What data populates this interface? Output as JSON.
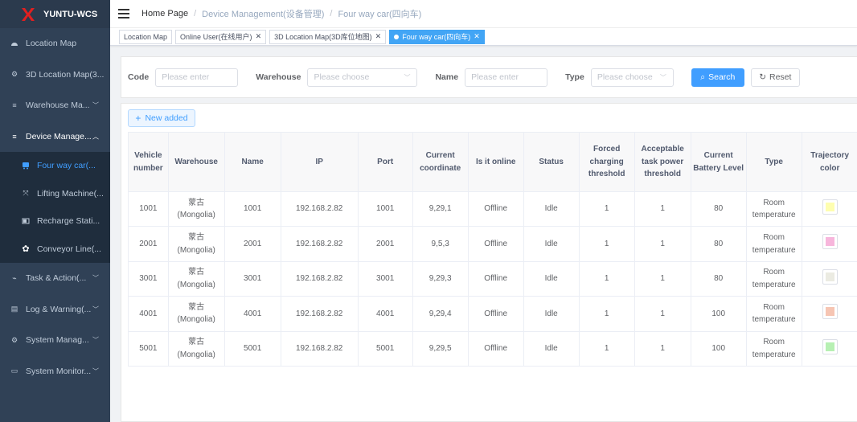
{
  "app": {
    "title": "YUNTU-WCS"
  },
  "sidebar": {
    "items": [
      {
        "label": "Location Map",
        "icon": "dashboard-icon"
      },
      {
        "label": "3D Location Map(3...",
        "icon": "gear-small-icon"
      },
      {
        "label": "Warehouse Ma...",
        "icon": "list-icon",
        "expandable": true
      },
      {
        "label": "Device Manage...",
        "icon": "list-icon",
        "expandable": true,
        "expanded": true,
        "children": [
          {
            "label": "Four way car(...",
            "icon": "bus-icon",
            "active": true
          },
          {
            "label": "Lifting Machine(...",
            "icon": "lift-icon"
          },
          {
            "label": "Recharge Stati...",
            "icon": "battery-icon"
          },
          {
            "label": "Conveyor Line(...",
            "icon": "cog-icon"
          }
        ]
      },
      {
        "label": "Task & Action(...",
        "icon": "task-icon",
        "expandable": true
      },
      {
        "label": "Log & Warning(...",
        "icon": "log-icon",
        "expandable": true
      },
      {
        "label": "System Manag...",
        "icon": "gear-small-icon",
        "expandable": true
      },
      {
        "label": "System Monitor...",
        "icon": "monitor-icon",
        "expandable": true
      }
    ]
  },
  "breadcrumb": {
    "home": "Home Page",
    "sep": "/",
    "level2": "Device Management(设备管理)",
    "level3": "Four way car(四向车)"
  },
  "tags": [
    {
      "label": "Location Map",
      "closable": false
    },
    {
      "label": "Online User(在线用户)",
      "closable": true
    },
    {
      "label": "3D Location Map(3D库位地图)",
      "closable": true
    },
    {
      "label": "Four way car(四向车)",
      "closable": true,
      "active": true
    }
  ],
  "search": {
    "code": {
      "label": "Code",
      "placeholder": "Please enter"
    },
    "warehouse": {
      "label": "Warehouse",
      "placeholder": "Please choose"
    },
    "name": {
      "label": "Name",
      "placeholder": "Please enter"
    },
    "type": {
      "label": "Type",
      "placeholder": "Please choose"
    },
    "search_label": "Search",
    "reset_label": "Reset"
  },
  "toolbar": {
    "new_label": "New added"
  },
  "table": {
    "headers": [
      "Vehicle number",
      "Warehouse",
      "Name",
      "IP",
      "Port",
      "Current coordinate",
      "Is it online",
      "Status",
      "Forced charging threshold",
      "Acceptable task power threshold",
      "Current Battery Level",
      "Type",
      "Trajectory color"
    ],
    "rows": [
      {
        "vehicle": "1001",
        "warehouse": "蒙古 (Mongolia)",
        "name": "1001",
        "ip": "192.168.2.82",
        "port": "1001",
        "coord": "9,29,1",
        "online": "Offline",
        "status": "Idle",
        "forced": "1",
        "acceptable": "1",
        "battery": "80",
        "type": "Room temperature",
        "color": "#fefeb0"
      },
      {
        "vehicle": "2001",
        "warehouse": "蒙古 (Mongolia)",
        "name": "2001",
        "ip": "192.168.2.82",
        "port": "2001",
        "coord": "9,5,3",
        "online": "Offline",
        "status": "Idle",
        "forced": "1",
        "acceptable": "1",
        "battery": "80",
        "type": "Room temperature",
        "color": "#f7b6dc"
      },
      {
        "vehicle": "3001",
        "warehouse": "蒙古 (Mongolia)",
        "name": "3001",
        "ip": "192.168.2.82",
        "port": "3001",
        "coord": "9,29,3",
        "online": "Offline",
        "status": "Idle",
        "forced": "1",
        "acceptable": "1",
        "battery": "80",
        "type": "Room temperature",
        "color": "#ebebe2"
      },
      {
        "vehicle": "4001",
        "warehouse": "蒙古 (Mongolia)",
        "name": "4001",
        "ip": "192.168.2.82",
        "port": "4001",
        "coord": "9,29,4",
        "online": "Offline",
        "status": "Idle",
        "forced": "1",
        "acceptable": "1",
        "battery": "100",
        "type": "Room temperature",
        "color": "#f6c5b3"
      },
      {
        "vehicle": "5001",
        "warehouse": "蒙古 (Mongolia)",
        "name": "5001",
        "ip": "192.168.2.82",
        "port": "5001",
        "coord": "9,29,5",
        "online": "Offline",
        "status": "Idle",
        "forced": "1",
        "acceptable": "1",
        "battery": "100",
        "type": "Room temperature",
        "color": "#b7f0b3"
      }
    ]
  }
}
